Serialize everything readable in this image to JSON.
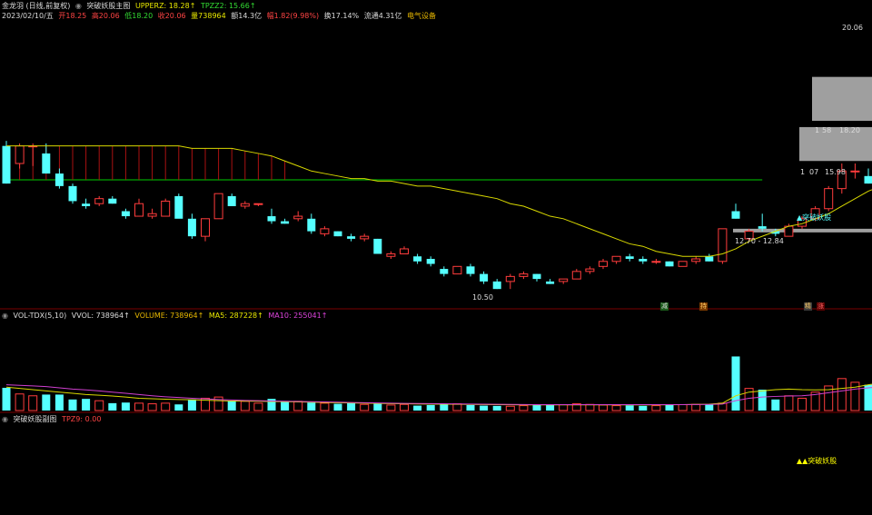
{
  "header": {
    "stock_title": "金龙羽 (日线,前复权)",
    "indicator_name": "突破妖股主图",
    "upperz": "UPPERZ: 18.28↑",
    "tpzz2": "TPZZ2: 15.66↑",
    "date": "2023/02/10/五",
    "open": "开18.25",
    "high": "高20.06",
    "low": "低18.20",
    "close": "收20.06",
    "volume": "量738964",
    "amount": "额14.3亿",
    "change": "幅1.82(9.98%)",
    "turnover": "换17.14%",
    "float_cap": "流通4.31亿",
    "sector": "电气设备"
  },
  "volume_header": {
    "name": "VOL-TDX(5,10)",
    "vvol": "VVOL: 738964↑",
    "volume": "VOLUME: 738964↑",
    "ma5": "MA5: 287228↑",
    "ma10": "MA10: 255041↑"
  },
  "sub_header": {
    "name": "突破妖股副图",
    "tpz9": "TPZ9: 0.00"
  },
  "annotations": {
    "high_label": "20.06",
    "low_label": "10.50",
    "level_1": "18.20",
    "level_2": "15.98",
    "partial_1": "1",
    "partial_2": "58",
    "partial_3": "1",
    "partial_4": "07",
    "range_label": "12.70 - 12.84",
    "breakout_label": "▲突破妖股",
    "sub_breakout_label": "▲▲突破妖股",
    "marker_1": "减",
    "marker_2": "持",
    "marker_3": "精",
    "marker_4": "涨"
  },
  "colors": {
    "up": "#ff3c3c",
    "down": "#55ffff",
    "ma_line": "#d8d800",
    "baseline": "#00cc00",
    "ma5": "#d8d800",
    "ma10": "#d040d0",
    "signal": "#ffff00",
    "box": "#bbbbbb"
  },
  "chart_data": {
    "type": "candlestick",
    "price_range": [
      10.0,
      21.0
    ],
    "candles": [
      [
        16.2,
        16.4,
        14.7,
        14.7
      ],
      [
        15.5,
        16.3,
        15.3,
        16.2
      ],
      [
        16.2,
        16.3,
        15.4,
        16.2
      ],
      [
        15.9,
        16.3,
        15.1,
        15.1
      ],
      [
        15.1,
        15.3,
        14.5,
        14.6
      ],
      [
        14.6,
        14.7,
        13.9,
        14.0
      ],
      [
        13.9,
        14.1,
        13.7,
        13.8
      ],
      [
        13.9,
        14.2,
        13.8,
        14.1
      ],
      [
        14.1,
        14.2,
        13.9,
        13.9
      ],
      [
        13.6,
        13.7,
        13.3,
        13.4
      ],
      [
        13.4,
        14.1,
        13.4,
        13.9
      ],
      [
        13.4,
        13.7,
        13.3,
        13.5
      ],
      [
        13.4,
        14.1,
        13.4,
        14.0
      ],
      [
        14.2,
        14.3,
        13.4,
        13.3
      ],
      [
        13.3,
        13.5,
        12.5,
        12.6
      ],
      [
        12.6,
        13.3,
        12.4,
        13.3
      ],
      [
        13.3,
        14.3,
        13.3,
        14.3
      ],
      [
        14.2,
        14.3,
        13.8,
        13.8
      ],
      [
        13.8,
        14.0,
        13.7,
        13.9
      ],
      [
        13.9,
        13.9,
        13.8,
        13.9
      ],
      [
        13.4,
        13.7,
        13.1,
        13.2
      ],
      [
        13.2,
        13.3,
        13.1,
        13.1
      ],
      [
        13.3,
        13.6,
        13.2,
        13.4
      ],
      [
        13.3,
        13.5,
        12.7,
        12.8
      ],
      [
        12.7,
        13.0,
        12.6,
        12.9
      ],
      [
        12.8,
        12.8,
        12.6,
        12.6
      ],
      [
        12.6,
        12.7,
        12.4,
        12.5
      ],
      [
        12.5,
        12.7,
        12.4,
        12.6
      ],
      [
        12.5,
        12.5,
        11.9,
        11.9
      ],
      [
        11.8,
        12.0,
        11.7,
        11.9
      ],
      [
        11.9,
        12.2,
        11.9,
        12.1
      ],
      [
        11.8,
        11.9,
        11.5,
        11.6
      ],
      [
        11.7,
        11.8,
        11.4,
        11.5
      ],
      [
        11.3,
        11.4,
        11.0,
        11.1
      ],
      [
        11.1,
        11.4,
        11.1,
        11.4
      ],
      [
        11.4,
        11.5,
        11.0,
        11.1
      ],
      [
        11.1,
        11.2,
        10.7,
        10.8
      ],
      [
        10.8,
        10.9,
        10.5,
        10.5
      ],
      [
        10.8,
        11.1,
        10.5,
        11.0
      ],
      [
        11.0,
        11.2,
        10.9,
        11.1
      ],
      [
        11.1,
        11.1,
        10.8,
        10.9
      ],
      [
        10.8,
        10.9,
        10.7,
        10.7
      ],
      [
        10.8,
        10.9,
        10.7,
        10.9
      ],
      [
        10.9,
        11.3,
        10.9,
        11.2
      ],
      [
        11.2,
        11.4,
        11.1,
        11.3
      ],
      [
        11.4,
        11.7,
        11.3,
        11.6
      ],
      [
        11.6,
        11.8,
        11.5,
        11.8
      ],
      [
        11.8,
        11.9,
        11.6,
        11.7
      ],
      [
        11.7,
        11.8,
        11.5,
        11.6
      ],
      [
        11.6,
        11.7,
        11.5,
        11.6
      ],
      [
        11.6,
        11.6,
        11.4,
        11.4
      ],
      [
        11.4,
        11.6,
        11.4,
        11.6
      ],
      [
        11.6,
        11.8,
        11.5,
        11.7
      ],
      [
        11.8,
        11.9,
        11.6,
        11.6
      ],
      [
        11.6,
        12.9,
        11.5,
        12.9
      ],
      [
        13.6,
        13.9,
        13.3,
        13.3
      ],
      [
        12.5,
        12.9,
        12.4,
        12.8
      ],
      [
        13.0,
        13.5,
        12.8,
        12.9
      ],
      [
        12.8,
        12.9,
        12.6,
        12.7
      ],
      [
        12.6,
        13.1,
        12.6,
        13.0
      ],
      [
        13.0,
        13.4,
        12.9,
        13.3
      ],
      [
        13.3,
        13.8,
        13.2,
        13.7
      ],
      [
        13.7,
        14.6,
        13.6,
        14.5
      ],
      [
        14.5,
        15.5,
        14.3,
        15.2
      ],
      [
        15.2,
        15.5,
        14.9,
        15.2
      ],
      [
        15.0,
        15.3,
        14.7,
        14.7
      ],
      [
        14.7,
        15.2,
        14.4,
        15.0
      ],
      [
        15.0,
        16.5,
        15.0,
        16.5
      ],
      [
        16.6,
        18.2,
        16.6,
        18.2
      ],
      [
        18.2,
        18.7,
        16.6,
        16.7
      ],
      [
        18.25,
        20.06,
        18.2,
        20.06
      ]
    ],
    "ma_line": [
      16.2,
      16.2,
      16.2,
      16.2,
      16.2,
      16.2,
      16.2,
      16.2,
      16.2,
      16.2,
      16.2,
      16.2,
      16.2,
      16.2,
      16.1,
      16.1,
      16.1,
      16.1,
      16.0,
      15.9,
      15.8,
      15.6,
      15.4,
      15.2,
      15.1,
      15.0,
      14.9,
      14.9,
      14.8,
      14.8,
      14.7,
      14.6,
      14.6,
      14.5,
      14.4,
      14.3,
      14.2,
      14.1,
      13.9,
      13.8,
      13.6,
      13.4,
      13.3,
      13.1,
      12.9,
      12.7,
      12.5,
      12.3,
      12.2,
      12.0,
      11.9,
      11.8,
      11.8,
      11.8,
      11.9,
      12.1,
      12.4,
      12.6,
      12.8,
      13.0,
      13.1,
      13.3,
      13.5,
      13.8,
      14.1,
      14.4,
      14.6,
      15.0,
      15.6,
      16.5,
      17.6
    ],
    "baseline_level": 14.85,
    "volume_max": 738964,
    "volume": [
      185000,
      135000,
      120000,
      130000,
      130000,
      90000,
      95000,
      80000,
      60000,
      65000,
      60000,
      55000,
      60000,
      50000,
      90000,
      100000,
      110000,
      80000,
      75000,
      60000,
      95000,
      70000,
      75000,
      65000,
      60000,
      55000,
      60000,
      50000,
      55000,
      45000,
      50000,
      40000,
      45000,
      50000,
      55000,
      45000,
      40000,
      38000,
      35000,
      40000,
      45000,
      50000,
      48000,
      55000,
      50000,
      45000,
      40000,
      42000,
      38000,
      40000,
      45000,
      48000,
      50000,
      50000,
      60000,
      440000,
      180000,
      170000,
      90000,
      120000,
      100000,
      150000,
      200000,
      260000,
      230000,
      210000,
      240000,
      260000,
      130000,
      70000,
      738964
    ],
    "ma5": [
      190000,
      180000,
      170000,
      160000,
      150000,
      140000,
      130000,
      125000,
      118000,
      110000,
      100000,
      96000,
      92000,
      90000,
      88000,
      84000,
      80000,
      78000,
      77000,
      76000,
      74000,
      72000,
      70000,
      68000,
      66000,
      64000,
      62000,
      60000,
      58000,
      56000,
      55000,
      54000,
      53000,
      52000,
      51000,
      50000,
      49000,
      48000,
      47000,
      46000,
      46000,
      46000,
      46000,
      46000,
      46000,
      46000,
      46000,
      46000,
      46000,
      46000,
      47000,
      48000,
      50000,
      52000,
      60000,
      120000,
      150000,
      160000,
      170000,
      175000,
      170000,
      168000,
      170000,
      180000,
      190000,
      210000,
      225000,
      240000,
      220000,
      200000,
      287228
    ],
    "ma10": [
      210000,
      205000,
      200000,
      195000,
      185000,
      175000,
      168000,
      160000,
      150000,
      140000,
      130000,
      120000,
      112000,
      106000,
      100000,
      95000,
      90000,
      86000,
      82000,
      80000,
      78000,
      76000,
      74000,
      72000,
      70000,
      68000,
      66000,
      64000,
      62000,
      60000,
      58000,
      57000,
      56000,
      55000,
      54000,
      53000,
      52000,
      51000,
      50000,
      49000,
      48000,
      48000,
      48000,
      48000,
      48000,
      48000,
      48000,
      48000,
      48000,
      48000,
      48000,
      48000,
      49000,
      50000,
      53000,
      80000,
      100000,
      110000,
      115000,
      118000,
      120000,
      130000,
      145000,
      160000,
      175000,
      185000,
      195000,
      205000,
      215000,
      230000,
      255041
    ]
  }
}
